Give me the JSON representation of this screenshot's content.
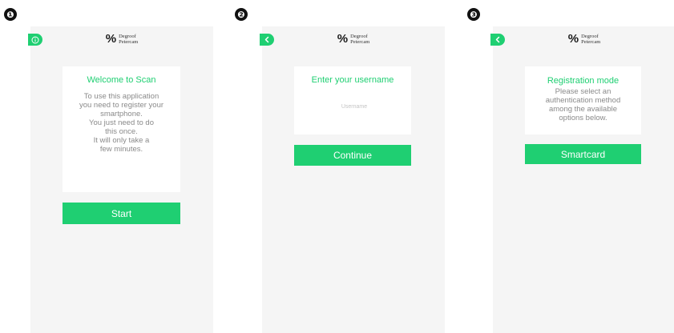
{
  "steps": [
    "❶",
    "❷",
    "❸"
  ],
  "colors": {
    "accent": "#1fcf72",
    "screen_bg": "#f5f5f5",
    "body_text": "#8a8a8a"
  },
  "logo": {
    "mark": "%",
    "line1": "Degroof",
    "line2": "Petercam"
  },
  "screen1": {
    "corner_icon": "info-icon",
    "title": "Welcome to Scan",
    "body_lines": [
      "To use this application",
      "you need to register your",
      "smartphone.",
      "You just need to do",
      "this once.",
      "It will only take a",
      "few minutes."
    ],
    "button": "Start"
  },
  "screen2": {
    "corner_icon": "back-chevron-icon",
    "title": "Enter your username",
    "input_placeholder": "Username",
    "input_value": "",
    "button": "Continue"
  },
  "screen3": {
    "corner_icon": "back-chevron-icon",
    "title": "Registration mode",
    "body_lines": [
      "Please select an",
      "authentication method",
      "among the available",
      "options below."
    ],
    "button": "Smartcard"
  }
}
